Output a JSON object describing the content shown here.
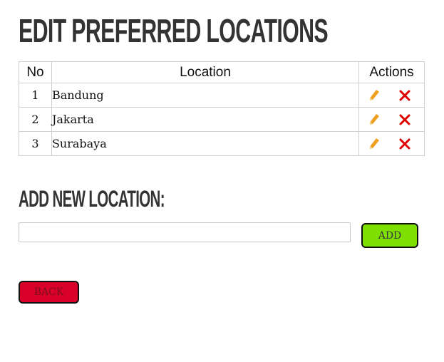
{
  "page": {
    "title": "Edit Preferred Locations",
    "add_heading": "Add New Location:"
  },
  "table": {
    "headers": {
      "no": "No",
      "location": "Location",
      "actions": "Actions"
    },
    "rows": [
      {
        "no": "1",
        "location": "Bandung"
      },
      {
        "no": "2",
        "location": "Jakarta"
      },
      {
        "no": "3",
        "location": "Surabaya"
      }
    ],
    "icons": {
      "edit": "pencil-icon",
      "delete": "close-icon"
    }
  },
  "new_location": {
    "value": "",
    "placeholder": ""
  },
  "buttons": {
    "add": "ADD",
    "back": "BACK"
  },
  "colors": {
    "heading": "#333333",
    "edit_icon": "#f0a020",
    "delete_icon": "#e00000",
    "add_button": "#7ee000",
    "back_button": "#d9002a"
  }
}
